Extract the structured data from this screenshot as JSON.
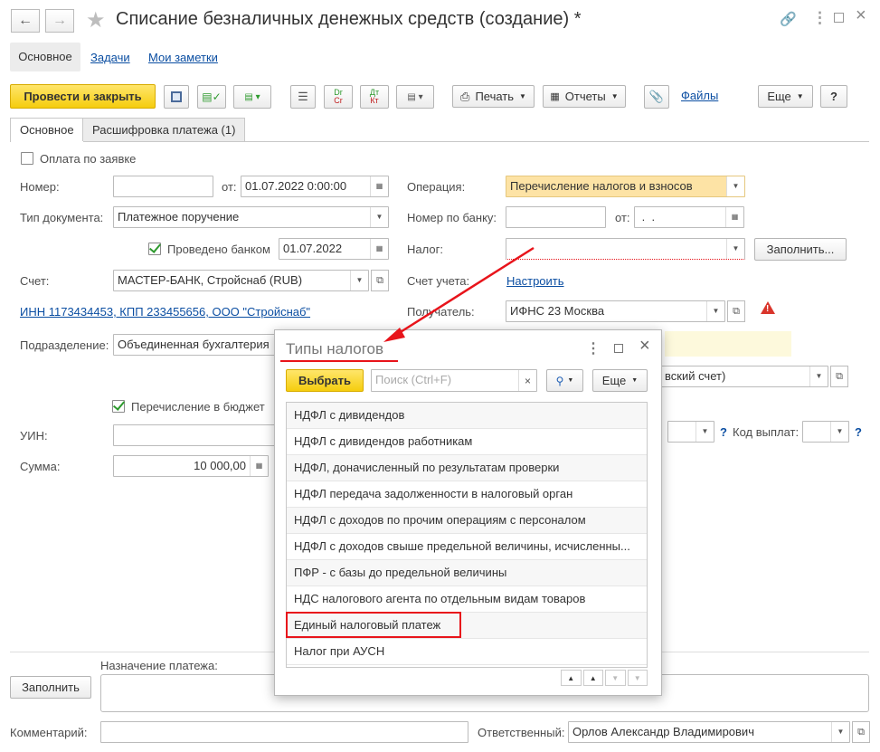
{
  "window": {
    "title": "Списание безналичных денежных средств (создание) *"
  },
  "top_tabs": [
    "Основное",
    "Задачи",
    "Мои заметки"
  ],
  "toolbar": {
    "post_close": "Провести и закрыть",
    "print": "Печать",
    "reports": "Отчеты",
    "files": "Файлы",
    "more": "Еще",
    "help": "?"
  },
  "form_tabs": [
    "Основное",
    "Расшифровка платежа (1)"
  ],
  "form": {
    "pay_by_request": "Оплата по заявке",
    "number_label": "Номер:",
    "number_value": "",
    "from_label": "от:",
    "date_value": "01.07.2022  0:00:00",
    "doc_type_label": "Тип документа:",
    "doc_type_value": "Платежное поручение",
    "posted_by_bank": "Проведено банком",
    "bank_date": "01.07.2022",
    "account_label": "Счет:",
    "account_value": "МАСТЕР-БАНК, Стройснаб (RUB)",
    "inn_link": "ИНН 1173434453, КПП 233455656, ООО \"Стройснаб\"",
    "division_label": "Подразделение:",
    "division_value": "Объединенная бухгалтерия",
    "budget_transfer": "Перечисление в бюджет",
    "uin_label": "УИН:",
    "sum_label": "Сумма:",
    "sum_value": "10 000,00",
    "operation_label": "Операция:",
    "operation_value": "Перечисление налогов и взносов",
    "bank_number_label": "Номер по банку:",
    "bank_from_label": "от:",
    "bank_from_value": " .  .",
    "tax_label": "Налог:",
    "fill_button": "Заполнить...",
    "account_acc_label": "Счет учета:",
    "setup_link": "Настроить",
    "recipient_label": "Получатель:",
    "recipient_value": "ИФНС 23 Москва",
    "recipient_account_partial": "вский счет)",
    "help_q": "?",
    "payment_code_label": "Код выплат:",
    "purpose_label": "Назначение платежа:",
    "fill_bottom": "Заполнить",
    "comment_label": "Комментарий:",
    "responsible_label": "Ответственный:",
    "responsible_value": "Орлов Александр Владимирович"
  },
  "popup": {
    "title": "Типы налогов",
    "select_button": "Выбрать",
    "search_placeholder": "Поиск (Ctrl+F)",
    "more": "Еще",
    "items": [
      "НДФЛ с дивидендов",
      "НДФЛ с дивидендов работникам",
      "НДФЛ, доначисленный по результатам проверки",
      "НДФЛ передача задолженности в налоговый орган",
      "НДФЛ с доходов по прочим операциям с персоналом",
      "НДФЛ с доходов свыше предельной величины, исчисленны...",
      "ПФР - с базы до предельной величины",
      "НДС налогового агента по отдельным видам товаров",
      "Единый налоговый платеж",
      "Налог при АУСН"
    ]
  },
  "colors": {
    "accent_yellow": "#f5cd0e",
    "highlight_red": "#e8141b",
    "link_blue": "#0b4ea2",
    "operation_bg": "#fde3a5"
  }
}
